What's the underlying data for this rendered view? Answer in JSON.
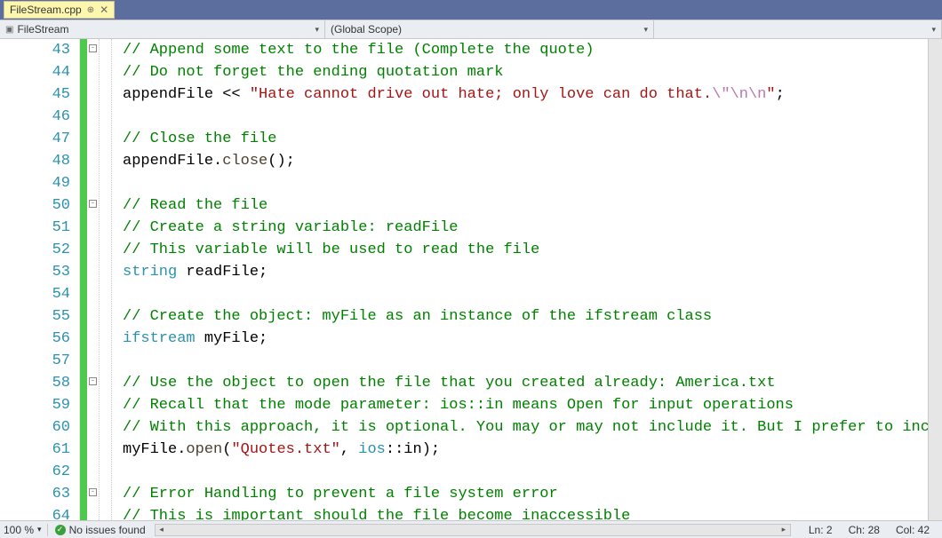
{
  "tab": {
    "title": "FileStream.cpp"
  },
  "nav": {
    "breadcrumb1": "FileStream",
    "breadcrumb2": "(Global Scope)"
  },
  "gutter": {
    "start": 43,
    "end": 64
  },
  "code": [
    {
      "n": 43,
      "outline": "-",
      "tokens": [
        {
          "t": "// Append some text to the file (Complete the quote)",
          "c": "c-comment"
        }
      ]
    },
    {
      "n": 44,
      "tokens": [
        {
          "t": "// Do not forget the ending quotation mark",
          "c": "c-comment"
        }
      ]
    },
    {
      "n": 45,
      "tokens": [
        {
          "t": "appendFile",
          "c": "c-plain"
        },
        {
          "t": " << ",
          "c": "c-plain"
        },
        {
          "t": "\"Hate cannot drive out hate; only love can do that.",
          "c": "c-string"
        },
        {
          "t": "\\\"\\n\\n",
          "c": "c-escape"
        },
        {
          "t": "\"",
          "c": "c-string"
        },
        {
          "t": ";",
          "c": "c-plain"
        }
      ]
    },
    {
      "n": 46,
      "tokens": []
    },
    {
      "n": 47,
      "tokens": [
        {
          "t": "// Close the file",
          "c": "c-comment"
        }
      ]
    },
    {
      "n": 48,
      "tokens": [
        {
          "t": "appendFile",
          "c": "c-plain"
        },
        {
          "t": ".",
          "c": "c-plain"
        },
        {
          "t": "close",
          "c": "c-member"
        },
        {
          "t": "();",
          "c": "c-plain"
        }
      ]
    },
    {
      "n": 49,
      "tokens": []
    },
    {
      "n": 50,
      "outline": "-",
      "tokens": [
        {
          "t": "// Read the file",
          "c": "c-comment"
        }
      ]
    },
    {
      "n": 51,
      "tokens": [
        {
          "t": "// Create a string variable: readFile",
          "c": "c-comment"
        }
      ]
    },
    {
      "n": 52,
      "tokens": [
        {
          "t": "// This variable will be used to read the file",
          "c": "c-comment"
        }
      ]
    },
    {
      "n": 53,
      "tokens": [
        {
          "t": "string",
          "c": "c-ns"
        },
        {
          "t": " readFile;",
          "c": "c-plain"
        }
      ]
    },
    {
      "n": 54,
      "tokens": []
    },
    {
      "n": 55,
      "tokens": [
        {
          "t": "// Create the object: myFile as an instance of the ifstream class",
          "c": "c-comment"
        }
      ]
    },
    {
      "n": 56,
      "tokens": [
        {
          "t": "ifstream",
          "c": "c-ns"
        },
        {
          "t": " myFile;",
          "c": "c-plain"
        }
      ]
    },
    {
      "n": 57,
      "tokens": []
    },
    {
      "n": 58,
      "outline": "-",
      "tokens": [
        {
          "t": "// Use the object to open the file that you created already: America.txt",
          "c": "c-comment"
        }
      ]
    },
    {
      "n": 59,
      "tokens": [
        {
          "t": "// Recall that the mode parameter: ios::in means Open for input operations",
          "c": "c-comment"
        }
      ]
    },
    {
      "n": 60,
      "tokens": [
        {
          "t": "// With this approach, it is optional. You may or may not include it. But I prefer to include it",
          "c": "c-comment"
        }
      ]
    },
    {
      "n": 61,
      "tokens": [
        {
          "t": "myFile",
          "c": "c-plain"
        },
        {
          "t": ".",
          "c": "c-plain"
        },
        {
          "t": "open",
          "c": "c-member"
        },
        {
          "t": "(",
          "c": "c-plain"
        },
        {
          "t": "\"Quotes.txt\"",
          "c": "c-string"
        },
        {
          "t": ", ",
          "c": "c-plain"
        },
        {
          "t": "ios",
          "c": "c-ns"
        },
        {
          "t": "::",
          "c": "c-plain"
        },
        {
          "t": "in",
          "c": "c-plain"
        },
        {
          "t": ");",
          "c": "c-plain"
        }
      ]
    },
    {
      "n": 62,
      "tokens": []
    },
    {
      "n": 63,
      "outline": "-",
      "tokens": [
        {
          "t": "// Error Handling to prevent a file system error",
          "c": "c-comment"
        }
      ]
    },
    {
      "n": 64,
      "tokens": [
        {
          "t": "// This is important should the file become inaccessible",
          "c": "c-comment"
        }
      ]
    }
  ],
  "status": {
    "zoom": "100 %",
    "issues": "No issues found",
    "ln_label": "Ln:",
    "ln_val": "2",
    "ch_label": "Ch:",
    "ch_val": "28",
    "col_label": "Col:",
    "col_val": "42"
  }
}
